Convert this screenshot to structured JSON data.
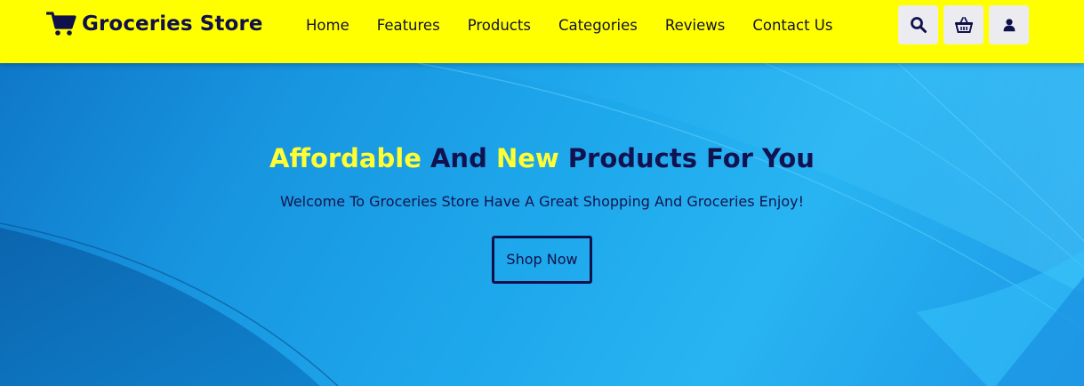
{
  "brand": {
    "name": "Groceries Store",
    "icon": "shopping-cart-icon"
  },
  "nav": {
    "items": [
      {
        "label": "Home"
      },
      {
        "label": "Features"
      },
      {
        "label": "Products"
      },
      {
        "label": "Categories"
      },
      {
        "label": "Reviews"
      },
      {
        "label": "Contact Us"
      }
    ]
  },
  "header_icons": [
    "search-icon",
    "basket-icon",
    "user-icon"
  ],
  "hero": {
    "headline": {
      "word1": "Affordable",
      "text2": "And",
      "word3": "New",
      "text4": "Products For You"
    },
    "subtitle": "Welcome To Groceries Store Have A Great Shopping And Groceries Enjoy!",
    "button_label": "Shop Now"
  },
  "colors": {
    "header_bg": "#ffff00",
    "brand_text": "#10104a",
    "highlight": "#ffff33",
    "hero_blue": "#1ea8ec"
  }
}
